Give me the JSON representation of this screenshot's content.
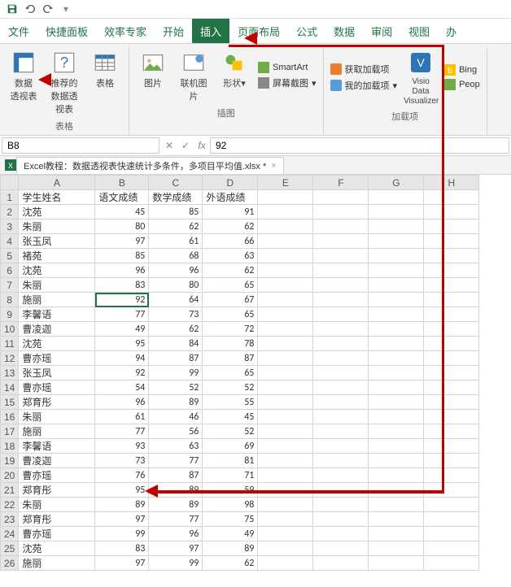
{
  "qat": {
    "save": "save",
    "undo": "undo",
    "redo": "redo"
  },
  "tabs": {
    "items": [
      {
        "label": "文件"
      },
      {
        "label": "快捷面板"
      },
      {
        "label": "效率专家"
      },
      {
        "label": "开始"
      },
      {
        "label": "插入",
        "active": true
      },
      {
        "label": "页面布局"
      },
      {
        "label": "公式"
      },
      {
        "label": "数据"
      },
      {
        "label": "审阅"
      },
      {
        "label": "视图"
      },
      {
        "label": "办"
      }
    ]
  },
  "ribbon": {
    "group_tables": {
      "name": "表格",
      "pivot": "数据\n透视表",
      "recPivot": "推荐的\n数据透视表",
      "table": "表格"
    },
    "group_illus": {
      "name": "插图",
      "pic": "图片",
      "online": "联机图片",
      "shapes": "形状",
      "smartart": "SmartArt",
      "screenshot": "屏幕截图"
    },
    "group_addins": {
      "name": "加载项",
      "get": "获取加载项",
      "my": "我的加载项",
      "visio": "Visio Data\nVisualizer",
      "bing": "Bing",
      "people": "Peop"
    }
  },
  "namebox": "B8",
  "fx_value": "92",
  "workbook_tab": "Excel教程：数据透视表快速统计多条件，多项目平均值.xlsx *",
  "columns": [
    "A",
    "B",
    "C",
    "D",
    "E",
    "F",
    "G",
    "H"
  ],
  "headers": {
    "A": "学生姓名",
    "B": "语文成绩",
    "C": "数学成绩",
    "D": "外语成绩"
  },
  "rows": [
    {
      "n": 1,
      "A": "学生姓名",
      "B": "语文成绩",
      "C": "数学成绩",
      "D": "外语成绩",
      "hdr": true
    },
    {
      "n": 2,
      "A": "沈苑",
      "B": 45,
      "C": 85,
      "D": 91
    },
    {
      "n": 3,
      "A": "朱丽",
      "B": 80,
      "C": 62,
      "D": 62
    },
    {
      "n": 4,
      "A": "张玉凤",
      "B": 97,
      "C": 61,
      "D": 66
    },
    {
      "n": 5,
      "A": "褚苑",
      "B": 85,
      "C": 68,
      "D": 63
    },
    {
      "n": 6,
      "A": "沈苑",
      "B": 96,
      "C": 96,
      "D": 62
    },
    {
      "n": 7,
      "A": "朱丽",
      "B": 83,
      "C": 80,
      "D": 65
    },
    {
      "n": 8,
      "A": "施丽",
      "B": 92,
      "C": 64,
      "D": 67,
      "sel": "B"
    },
    {
      "n": 9,
      "A": "李馨语",
      "B": 77,
      "C": 73,
      "D": 65
    },
    {
      "n": 10,
      "A": "曹凌迦",
      "B": 49,
      "C": 62,
      "D": 72
    },
    {
      "n": 11,
      "A": "沈苑",
      "B": 95,
      "C": 84,
      "D": 78
    },
    {
      "n": 12,
      "A": "曹亦瑶",
      "B": 94,
      "C": 87,
      "D": 87
    },
    {
      "n": 13,
      "A": "张玉凤",
      "B": 92,
      "C": 99,
      "D": 65
    },
    {
      "n": 14,
      "A": "曹亦瑶",
      "B": 54,
      "C": 52,
      "D": 52
    },
    {
      "n": 15,
      "A": "郑育彤",
      "B": 96,
      "C": 89,
      "D": 55
    },
    {
      "n": 16,
      "A": "朱丽",
      "B": 61,
      "C": 46,
      "D": 45
    },
    {
      "n": 17,
      "A": "施丽",
      "B": 77,
      "C": 56,
      "D": 52
    },
    {
      "n": 18,
      "A": "李馨语",
      "B": 93,
      "C": 63,
      "D": 69
    },
    {
      "n": 19,
      "A": "曹凌迦",
      "B": 73,
      "C": 77,
      "D": 81
    },
    {
      "n": 20,
      "A": "曹亦瑶",
      "B": 76,
      "C": 87,
      "D": 71
    },
    {
      "n": 21,
      "A": "郑育彤",
      "B": 95,
      "C": 89,
      "D": 59
    },
    {
      "n": 22,
      "A": "朱丽",
      "B": 89,
      "C": 89,
      "D": 98
    },
    {
      "n": 23,
      "A": "郑育彤",
      "B": 97,
      "C": 77,
      "D": 75
    },
    {
      "n": 24,
      "A": "曹亦瑶",
      "B": 99,
      "C": 96,
      "D": 49
    },
    {
      "n": 25,
      "A": "沈苑",
      "B": 83,
      "C": 97,
      "D": 89
    },
    {
      "n": 26,
      "A": "施丽",
      "B": 97,
      "C": 99,
      "D": 62
    }
  ],
  "arrows": {
    "color": "#c00000"
  }
}
